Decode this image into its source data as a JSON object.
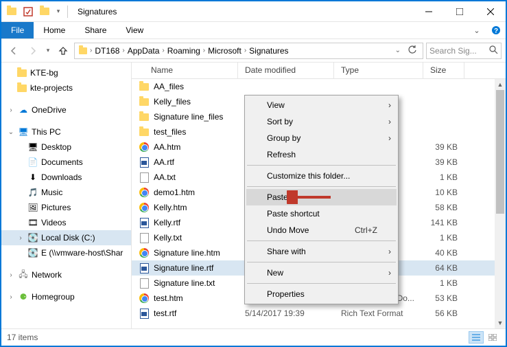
{
  "titlebar": {
    "title": "Signatures"
  },
  "ribbon": {
    "file": "File",
    "home": "Home",
    "share": "Share",
    "view": "View"
  },
  "breadcrumb": {
    "segments": [
      "DT168",
      "AppData",
      "Roaming",
      "Microsoft",
      "Signatures"
    ]
  },
  "search": {
    "placeholder": "Search Sig..."
  },
  "navpane": {
    "quick": [
      {
        "label": "KTE-bg",
        "icon": "folder"
      },
      {
        "label": "kte-projects",
        "icon": "folder"
      }
    ],
    "onedrive": "OneDrive",
    "thispc": {
      "label": "This PC",
      "children": [
        {
          "label": "Desktop",
          "icon": "desktop"
        },
        {
          "label": "Documents",
          "icon": "documents"
        },
        {
          "label": "Downloads",
          "icon": "downloads"
        },
        {
          "label": "Music",
          "icon": "music"
        },
        {
          "label": "Pictures",
          "icon": "pictures"
        },
        {
          "label": "Videos",
          "icon": "videos"
        },
        {
          "label": "Local Disk (C:)",
          "icon": "drive",
          "selected": true
        },
        {
          "label": "E (\\\\vmware-host\\Shar",
          "icon": "netdrive"
        }
      ]
    },
    "network": "Network",
    "homegroup": "Homegroup"
  },
  "columns": {
    "name": "Name",
    "date": "Date modified",
    "type": "Type",
    "size": "Size"
  },
  "files": [
    {
      "name": "AA_files",
      "date": "",
      "type": "",
      "size": "",
      "icon": "folder"
    },
    {
      "name": "Kelly_files",
      "date": "",
      "type": "",
      "size": "",
      "icon": "folder"
    },
    {
      "name": "Signature line_files",
      "date": "",
      "type": "",
      "size": "",
      "icon": "folder"
    },
    {
      "name": "test_files",
      "date": "",
      "type": "",
      "size": "",
      "icon": "folder"
    },
    {
      "name": "AA.htm",
      "date": "",
      "type": "L Do...",
      "size": "39 KB",
      "icon": "chrome"
    },
    {
      "name": "AA.rtf",
      "date": "",
      "type": "nat",
      "size": "39 KB",
      "icon": "rtf"
    },
    {
      "name": "AA.txt",
      "date": "",
      "type": "t",
      "size": "1 KB",
      "icon": "txt"
    },
    {
      "name": "demo1.htm",
      "date": "",
      "type": "L Do...",
      "size": "10 KB",
      "icon": "chrome"
    },
    {
      "name": "Kelly.htm",
      "date": "",
      "type": "L Do...",
      "size": "58 KB",
      "icon": "chrome"
    },
    {
      "name": "Kelly.rtf",
      "date": "",
      "type": "nat",
      "size": "141 KB",
      "icon": "rtf"
    },
    {
      "name": "Kelly.txt",
      "date": "",
      "type": "t",
      "size": "1 KB",
      "icon": "txt"
    },
    {
      "name": "Signature line.htm",
      "date": "",
      "type": "L Do...",
      "size": "40 KB",
      "icon": "chrome"
    },
    {
      "name": "Signature line.rtf",
      "date": "",
      "type": "nat",
      "size": "64 KB",
      "icon": "rtf",
      "selected": true
    },
    {
      "name": "Signature line.txt",
      "date": "",
      "type": "t",
      "size": "1 KB",
      "icon": "txt"
    },
    {
      "name": "test.htm",
      "date": "5/14/2017 19:39",
      "type": "Chrome HTML Do...",
      "size": "53 KB",
      "icon": "chrome"
    },
    {
      "name": "test.rtf",
      "date": "5/14/2017 19:39",
      "type": "Rich Text Format",
      "size": "56 KB",
      "icon": "rtf"
    }
  ],
  "contextmenu": {
    "view": "View",
    "sortby": "Sort by",
    "groupby": "Group by",
    "refresh": "Refresh",
    "customize": "Customize this folder...",
    "paste": "Paste",
    "pasteshortcut": "Paste shortcut",
    "undomove": "Undo Move",
    "undomove_accel": "Ctrl+Z",
    "sharewith": "Share with",
    "new": "New",
    "properties": "Properties"
  },
  "statusbar": {
    "count": "17 items"
  }
}
